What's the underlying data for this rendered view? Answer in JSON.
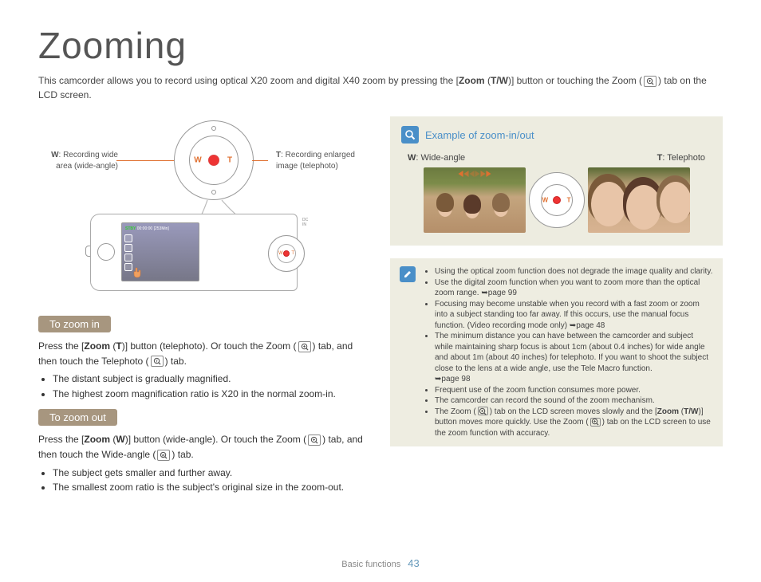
{
  "page": {
    "title": "Zooming",
    "intro_pre": "This camcorder allows you to record using optical X20 zoom and digital X40 zoom by pressing the [",
    "intro_zoom": "Zoom",
    "intro_mid": " (",
    "intro_tw": "T/W",
    "intro_post1": ")] button or touching the Zoom (",
    "intro_post2": ") tab on the LCD screen."
  },
  "diagram": {
    "w_label_b": "W",
    "w_label": ": Recording wide area (wide-angle)",
    "t_label_b": "T",
    "t_label": ": Recording enlarged image (telephoto)",
    "dial_w": "W",
    "dial_t": "T",
    "screen_stby": "STBY",
    "screen_time": "00:00:00 [253Min]",
    "side_w": "W",
    "side_t": "T",
    "jack": "DC IN"
  },
  "zoom_in": {
    "heading": "To zoom in",
    "p1a": "Press the [",
    "p1b": "Zoom",
    "p1c": " (",
    "p1d": "T",
    "p1e": ")] button (telephoto). Or touch the Zoom (",
    "p1f": ") tab, and then touch the Telephoto (",
    "p1g": ") tab.",
    "b1": "The distant subject is gradually magnified.",
    "b2": "The highest zoom magnification ratio is X20 in the normal zoom-in."
  },
  "zoom_out": {
    "heading": "To zoom out",
    "p1a": "Press the [",
    "p1b": "Zoom",
    "p1c": " (",
    "p1d": "W",
    "p1e": ")] button (wide-angle). Or touch the Zoom (",
    "p1f": ") tab, and then touch the Wide-angle (",
    "p1g": ") tab.",
    "b1": "The subject gets smaller and further away.",
    "b2": "The smallest zoom ratio is the subject's original size in the zoom-out."
  },
  "example": {
    "title": "Example of zoom-in/out",
    "w_label_b": "W",
    "w_label": ": Wide-angle",
    "t_label_b": "T",
    "t_label": ": Telephoto",
    "dial_w": "W",
    "dial_t": "T"
  },
  "notes": {
    "n1": "Using the optical zoom function does not degrade the image quality and clarity.",
    "n2a": "Use the digital zoom function when you want to zoom more than the optical zoom range. ",
    "n2b": "page 99",
    "n3a": "Focusing may become unstable when you record with a fast zoom or zoom into a subject standing too far away. If this occurs, use the manual focus function. (Video recording mode only) ",
    "n3b": "page 48",
    "n4a": "The minimum distance you can have between the camcorder and subject while maintaining sharp focus is about 1cm (about 0.4 inches) for wide angle and about 1m (about 40 inches) for telephoto. If you want to shoot the subject close to the lens at a wide angle, use the Tele Macro function. ",
    "n4b": "page 98",
    "n5": "Frequent use of the zoom function consumes more power.",
    "n6": "The camcorder can record the sound of the zoom mechanism.",
    "n7a": "The Zoom (",
    "n7b": ") tab on the LCD screen moves slowly and the [",
    "n7c": "Zoom",
    "n7d": " (",
    "n7e": "T/W",
    "n7f": ")] button moves more quickly. Use the Zoom (",
    "n7g": ") tab on the LCD screen to use the zoom function with accuracy."
  },
  "footer": {
    "section": "Basic functions",
    "page": "43"
  }
}
